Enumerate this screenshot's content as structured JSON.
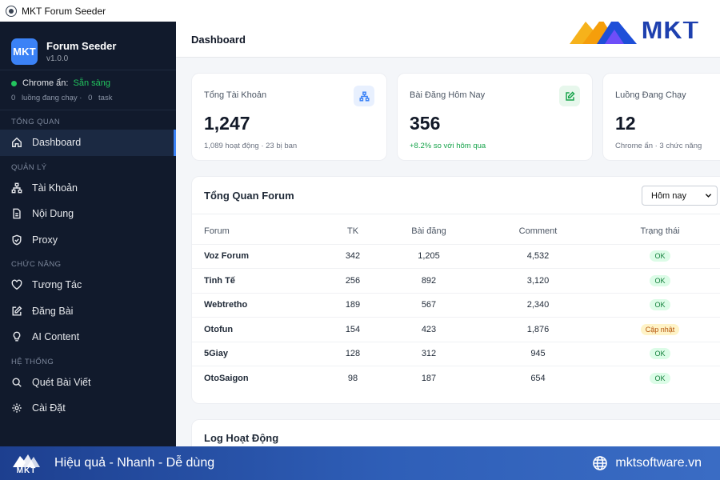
{
  "window": {
    "title": "MKT Forum Seeder"
  },
  "sidebar": {
    "brand_logo": "MKT",
    "brand_name": "Forum Seeder",
    "version": "v1.0.0",
    "status_label": "Chrome ẩn:",
    "status_value": "Sẵn sàng",
    "threads_count": "0",
    "threads_label": "luồng đang chạy ·",
    "tasks_count": "0",
    "tasks_label": "task",
    "sections": {
      "overview": "TỔNG QUAN",
      "manage": "QUẢN LÝ",
      "features": "CHỨC NĂNG",
      "system": "HỆ THỐNG"
    },
    "items": {
      "dashboard": "Dashboard",
      "accounts": "Tài Khoản",
      "content": "Nội Dung",
      "proxy": "Proxy",
      "interact": "Tương Tác",
      "post": "Đăng Bài",
      "ai": "AI Content",
      "scan": "Quét Bài Viết",
      "settings": "Cài Đặt"
    }
  },
  "header": {
    "title": "Dashboard",
    "logo_text": "MKT"
  },
  "cards": [
    {
      "label": "Tổng Tài Khoản",
      "value": "1,247",
      "sub": "1,089 hoạt động · 23 bị ban",
      "icon": "network-icon"
    },
    {
      "label": "Bài Đăng Hôm Nay",
      "value": "356",
      "sub": "+8.2% so với hôm qua",
      "icon": "edit-icon"
    },
    {
      "label": "Luồng Đang Chạy",
      "value": "12",
      "sub": "Chrome ẩn · 3 chức năng"
    }
  ],
  "forum_panel": {
    "title": "Tổng Quan Forum",
    "filter_value": "Hôm nay",
    "columns": [
      "Forum",
      "TK",
      "Bài đăng",
      "Comment",
      "Trạng thái"
    ],
    "rows": [
      {
        "forum": "Voz Forum",
        "tk": "342",
        "posts": "1,205",
        "comments": "4,532",
        "status": "OK"
      },
      {
        "forum": "Tinh Tế",
        "tk": "256",
        "posts": "892",
        "comments": "3,120",
        "status": "OK"
      },
      {
        "forum": "Webtretho",
        "tk": "189",
        "posts": "567",
        "comments": "2,340",
        "status": "OK"
      },
      {
        "forum": "Otofun",
        "tk": "154",
        "posts": "423",
        "comments": "1,876",
        "status": "Cập nhật"
      },
      {
        "forum": "5Giay",
        "tk": "128",
        "posts": "312",
        "comments": "945",
        "status": "OK"
      },
      {
        "forum": "OtoSaigon",
        "tk": "98",
        "posts": "187",
        "comments": "654",
        "status": "OK"
      }
    ]
  },
  "log_panel": {
    "title": "Log Hoạt Động"
  },
  "banner": {
    "logo_text": "MKT",
    "slogan": "Hiệu quả - Nhanh - Dễ dùng",
    "website": "mktsoftware.vn"
  },
  "colors": {
    "sidebar_bg": "#111a2c",
    "accent": "#3b82f6",
    "ok_green": "#16a34a",
    "update_amber": "#b45309",
    "banner_blue": "#1d3f8f"
  }
}
